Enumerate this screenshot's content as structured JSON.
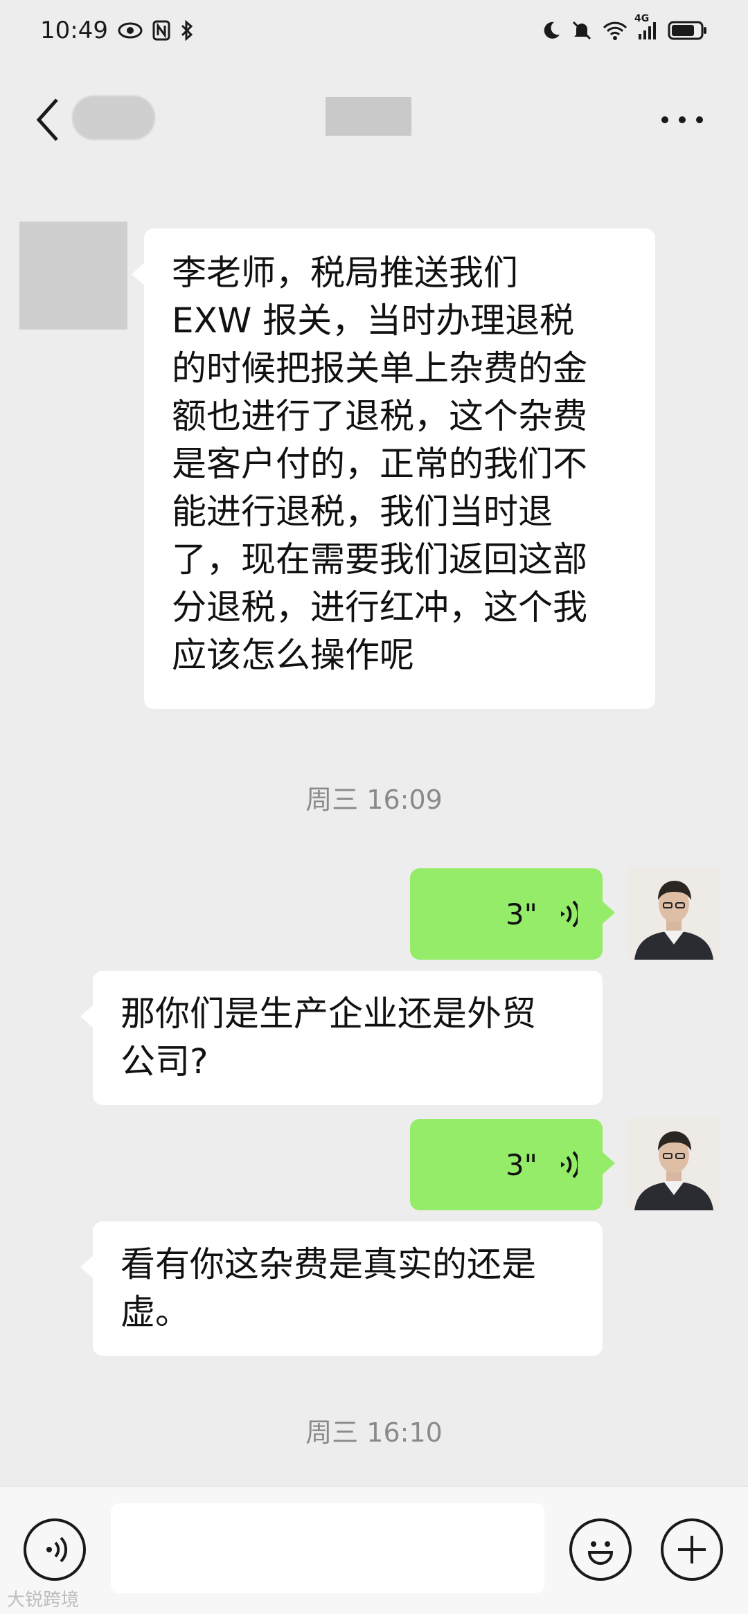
{
  "status_bar": {
    "time": "10:49",
    "network_label": "4G"
  },
  "chat": {
    "messages": [
      {
        "side": "left",
        "type": "text",
        "text": "李老师，税局推送我们\nEXW 报关，当时办理退税\n的时候把报关单上杂费的金\n额也进行了退税，这个杂费\n是客户付的，正常的我们不\n能进行退税，我们当时退\n了，现在需要我们返回这部\n分退税，进行红冲，这个我\n应该怎么操作呢"
      },
      {
        "type": "timestamp",
        "text": "周三 16:09"
      },
      {
        "side": "right",
        "type": "voice",
        "duration": "3\""
      },
      {
        "side": "left",
        "type": "text",
        "text": "那你们是生产企业还是外贸\n公司?"
      },
      {
        "side": "right",
        "type": "voice",
        "duration": "3\""
      },
      {
        "side": "left",
        "type": "text",
        "text": "看有你这杂费是真实的还是\n虚。"
      },
      {
        "type": "timestamp",
        "text": "周三 16:10"
      }
    ]
  },
  "colors": {
    "background": "#ededed",
    "sent_bubble": "#95ec69",
    "received_bubble": "#ffffff"
  },
  "watermark": "大锐跨境"
}
